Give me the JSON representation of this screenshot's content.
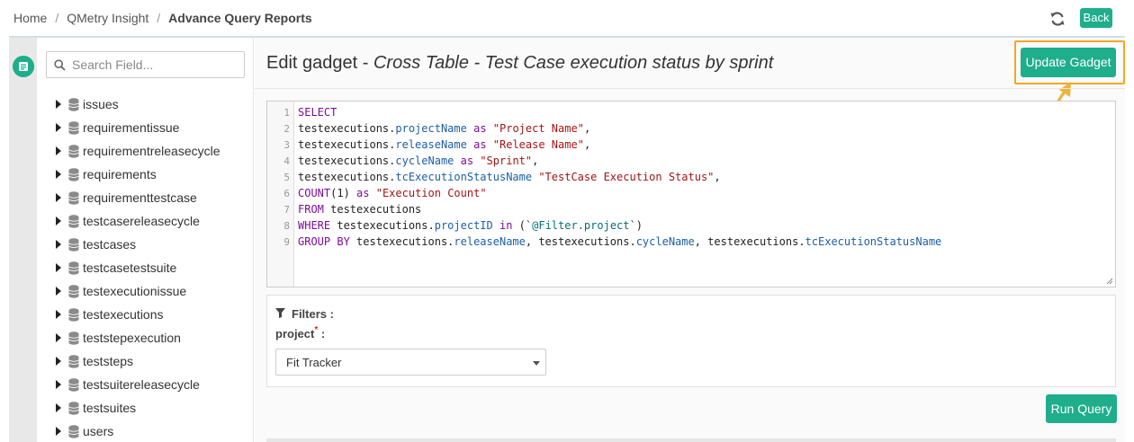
{
  "breadcrumb": {
    "items": [
      "Home",
      "QMetry Insight",
      "Advance Query Reports"
    ],
    "separator": "/"
  },
  "header": {
    "back_label": "Back",
    "refresh_icon": "refresh-icon"
  },
  "sidebar": {
    "search_placeholder": "Search Field...",
    "tables": [
      "issues",
      "requirementissue",
      "requirementreleasecycle",
      "requirements",
      "requirementtestcase",
      "testcasereleasecycle",
      "testcases",
      "testcasetestsuite",
      "testexecutionissue",
      "testexecutions",
      "teststepexecution",
      "teststeps",
      "testsuitereleasecycle",
      "testsuites",
      "users"
    ]
  },
  "main": {
    "title_prefix": "Edit gadget - ",
    "gadget_name": "Cross Table - Test Case execution status by sprint",
    "update_label": "Update Gadget",
    "run_label": "Run Query"
  },
  "query": {
    "line_numbers": [
      "1",
      "2",
      "3",
      "4",
      "5",
      "6",
      "7",
      "8",
      "9"
    ],
    "lines": [
      "SELECT",
      "testexecutions.projectName as \"Project Name\",",
      "testexecutions.releaseName as \"Release Name\",",
      "testexecutions.cycleName as \"Sprint\",",
      "testexecutions.tcExecutionStatusName \"TestCase Execution Status\",",
      "COUNT(1) as \"Execution Count\"",
      "FROM testexecutions",
      "WHERE testexecutions.projectID in (`@Filter.project`)",
      "GROUP BY testexecutions.releaseName, testexecutions.cycleName, testexecutions.tcExecutionStatusName"
    ]
  },
  "filters": {
    "heading": "Filters :",
    "project_label": "project",
    "required_mark": "*",
    "colon": " :",
    "project_value": "Fit Tracker"
  },
  "colors": {
    "accent": "#1fae8c",
    "highlight": "#f5a623"
  }
}
